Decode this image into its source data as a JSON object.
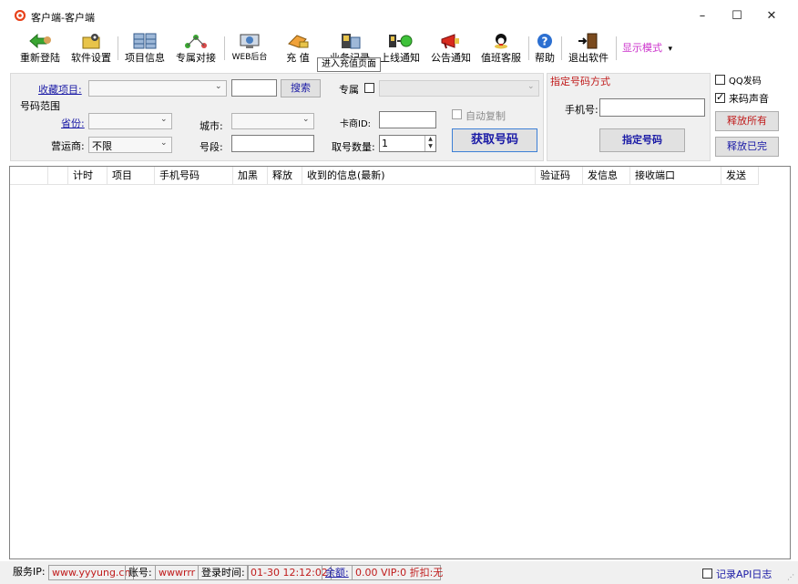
{
  "window": {
    "title": "客户端-客户端",
    "minimize": "–",
    "maximize": "☐",
    "close": "✕"
  },
  "toolbar": {
    "items": [
      {
        "label": "重新登陆",
        "icon": "relogin-arrow-icon"
      },
      {
        "label": "软件设置",
        "icon": "settings-icon"
      },
      {
        "label": "项目信息",
        "icon": "project-info-icon"
      },
      {
        "label": "专属对接",
        "icon": "exclusive-connect-icon"
      },
      {
        "label": "WEB后台",
        "icon": "web-backend-icon"
      },
      {
        "label": "充 值",
        "icon": "recharge-icon"
      },
      {
        "label": "业务记录",
        "icon": "business-record-icon"
      },
      {
        "label": "上线通知",
        "icon": "online-notice-icon"
      },
      {
        "label": "公告通知",
        "icon": "announcement-icon"
      },
      {
        "label": "值班客服",
        "icon": "customer-service-icon"
      },
      {
        "label": "帮助",
        "icon": "help-icon"
      },
      {
        "label": "退出软件",
        "icon": "exit-icon"
      }
    ],
    "display_mode": "显示模式",
    "tooltip": "进入充值页面"
  },
  "left_panel": {
    "favorites_label": "收藏项目:",
    "favorites_value": "",
    "search_input": "",
    "search_button": "搜索",
    "exclusive_label": "专属",
    "exclusive_value": "",
    "number_range": "号码范围",
    "province_label": "省份:",
    "province_value": "",
    "city_label": "城市:",
    "city_value": "",
    "card_id_label": "卡商ID:",
    "card_id_value": "",
    "auto_copy_label": "自动复制",
    "operator_label": "营运商:",
    "operator_value": "不限",
    "segment_label": "号段:",
    "segment_value": "",
    "count_label": "取号数量:",
    "count_value": "1",
    "get_number_button": "获取号码"
  },
  "right_panel": {
    "title": "指定号码方式",
    "phone_label": "手机号:",
    "phone_value": "",
    "specify_button": "指定号码"
  },
  "side_options": {
    "qq_sms_label": "QQ发码",
    "qq_sms_checked": false,
    "sound_label": "来码声音",
    "sound_checked": true,
    "release_all": "释放所有",
    "release_done": "释放已完"
  },
  "table": {
    "columns": [
      "",
      "计时",
      "项目",
      "手机号码",
      "加黑",
      "释放",
      "收到的信息(最新)",
      "验证码",
      "发信息",
      "接收端口",
      "发送"
    ],
    "rows": []
  },
  "status": {
    "server_ip_label": "服务IP:",
    "server_ip": "www.yyyung.cn",
    "account_label": "账号:",
    "account": "wwwrrr",
    "login_time_label": "登录时间:",
    "login_time": "01-30 12:12:02",
    "balance_label": "余额:",
    "balance_info": "0.00  VIP:0 折扣:无",
    "api_log_label": "记录API日志"
  },
  "colors": {
    "accent_red": "#c01b1b",
    "link_blue": "#1a1aa6",
    "display_mode": "#cc33cc"
  }
}
